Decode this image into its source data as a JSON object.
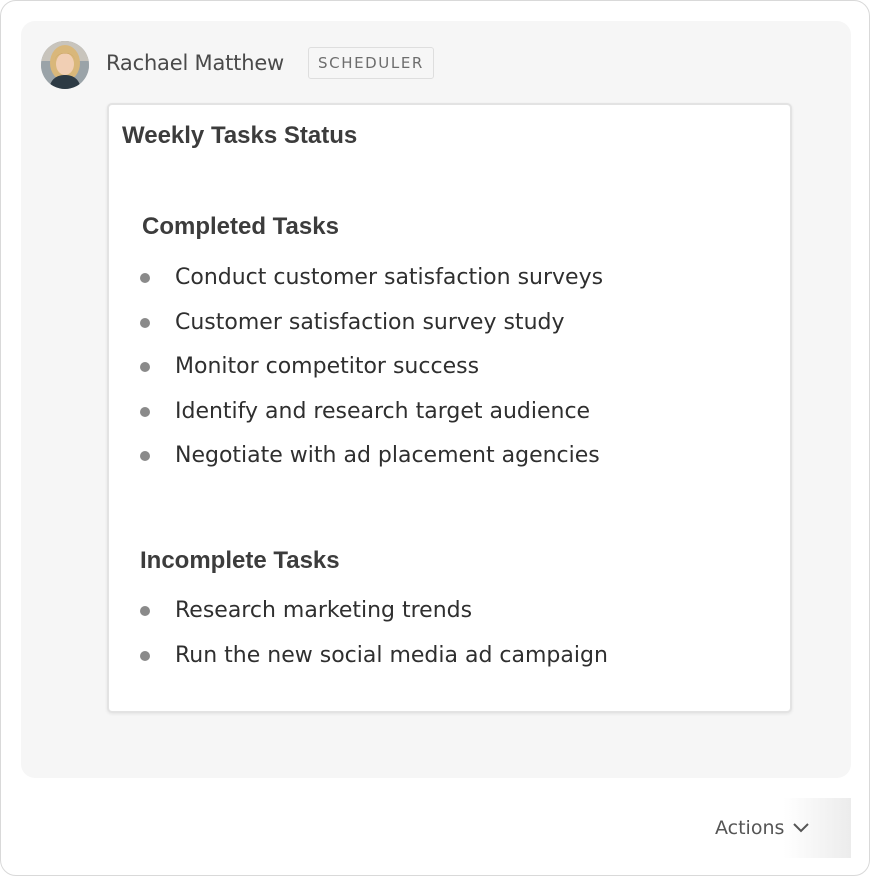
{
  "author": {
    "name": "Rachael Matthew",
    "role": "SCHEDULER",
    "avatar_icon": "user-avatar-photo"
  },
  "card": {
    "title": "Weekly Tasks Status",
    "completed": {
      "heading": "Completed Tasks",
      "items": [
        "Conduct customer satisfaction surveys",
        "Customer satisfaction survey study",
        "Monitor competitor success",
        "Identify and research target audience",
        "Negotiate with ad placement agencies"
      ]
    },
    "incomplete": {
      "heading": "Incomplete Tasks",
      "items": [
        "Research marketing trends",
        "Run the new social media ad campaign"
      ]
    }
  },
  "footer": {
    "actions_label": "Actions",
    "actions_icon": "chevron-down-icon"
  },
  "colors": {
    "panel_background": "#f6f6f6",
    "card_border": "#e3e3e3",
    "text_primary": "#2f2f2f",
    "bullet": "#8a8a8a"
  }
}
